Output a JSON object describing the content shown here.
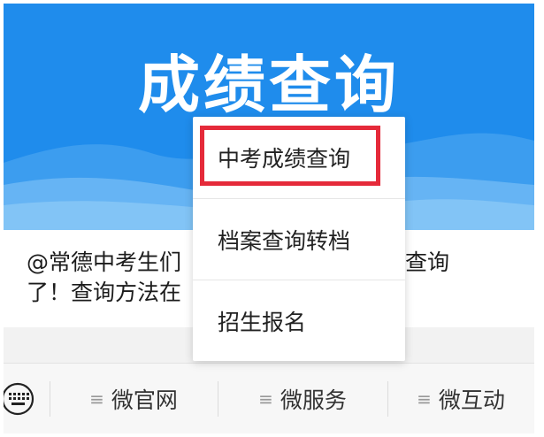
{
  "banner": {
    "title": "成绩查询"
  },
  "article": {
    "line1_left": "@常德中考生们",
    "line1_right": "可查询",
    "line2_left": "了！查询方法在"
  },
  "bottom_menu": {
    "keyboard_icon": "keyboard-icon",
    "items": [
      {
        "label": "微官网"
      },
      {
        "label": "微服务"
      },
      {
        "label": "微互动"
      }
    ],
    "menu_icon_glyph": "≡"
  },
  "popup_menu": {
    "items": [
      {
        "label": "中考成绩查询",
        "highlighted": true
      },
      {
        "label": "档案查询转档",
        "highlighted": false
      },
      {
        "label": "招生报名",
        "highlighted": false
      }
    ],
    "highlight_color": "#e52a3a"
  },
  "colors": {
    "banner_blue": "#1f8cec",
    "banner_cloud": "#5fb2f2"
  }
}
